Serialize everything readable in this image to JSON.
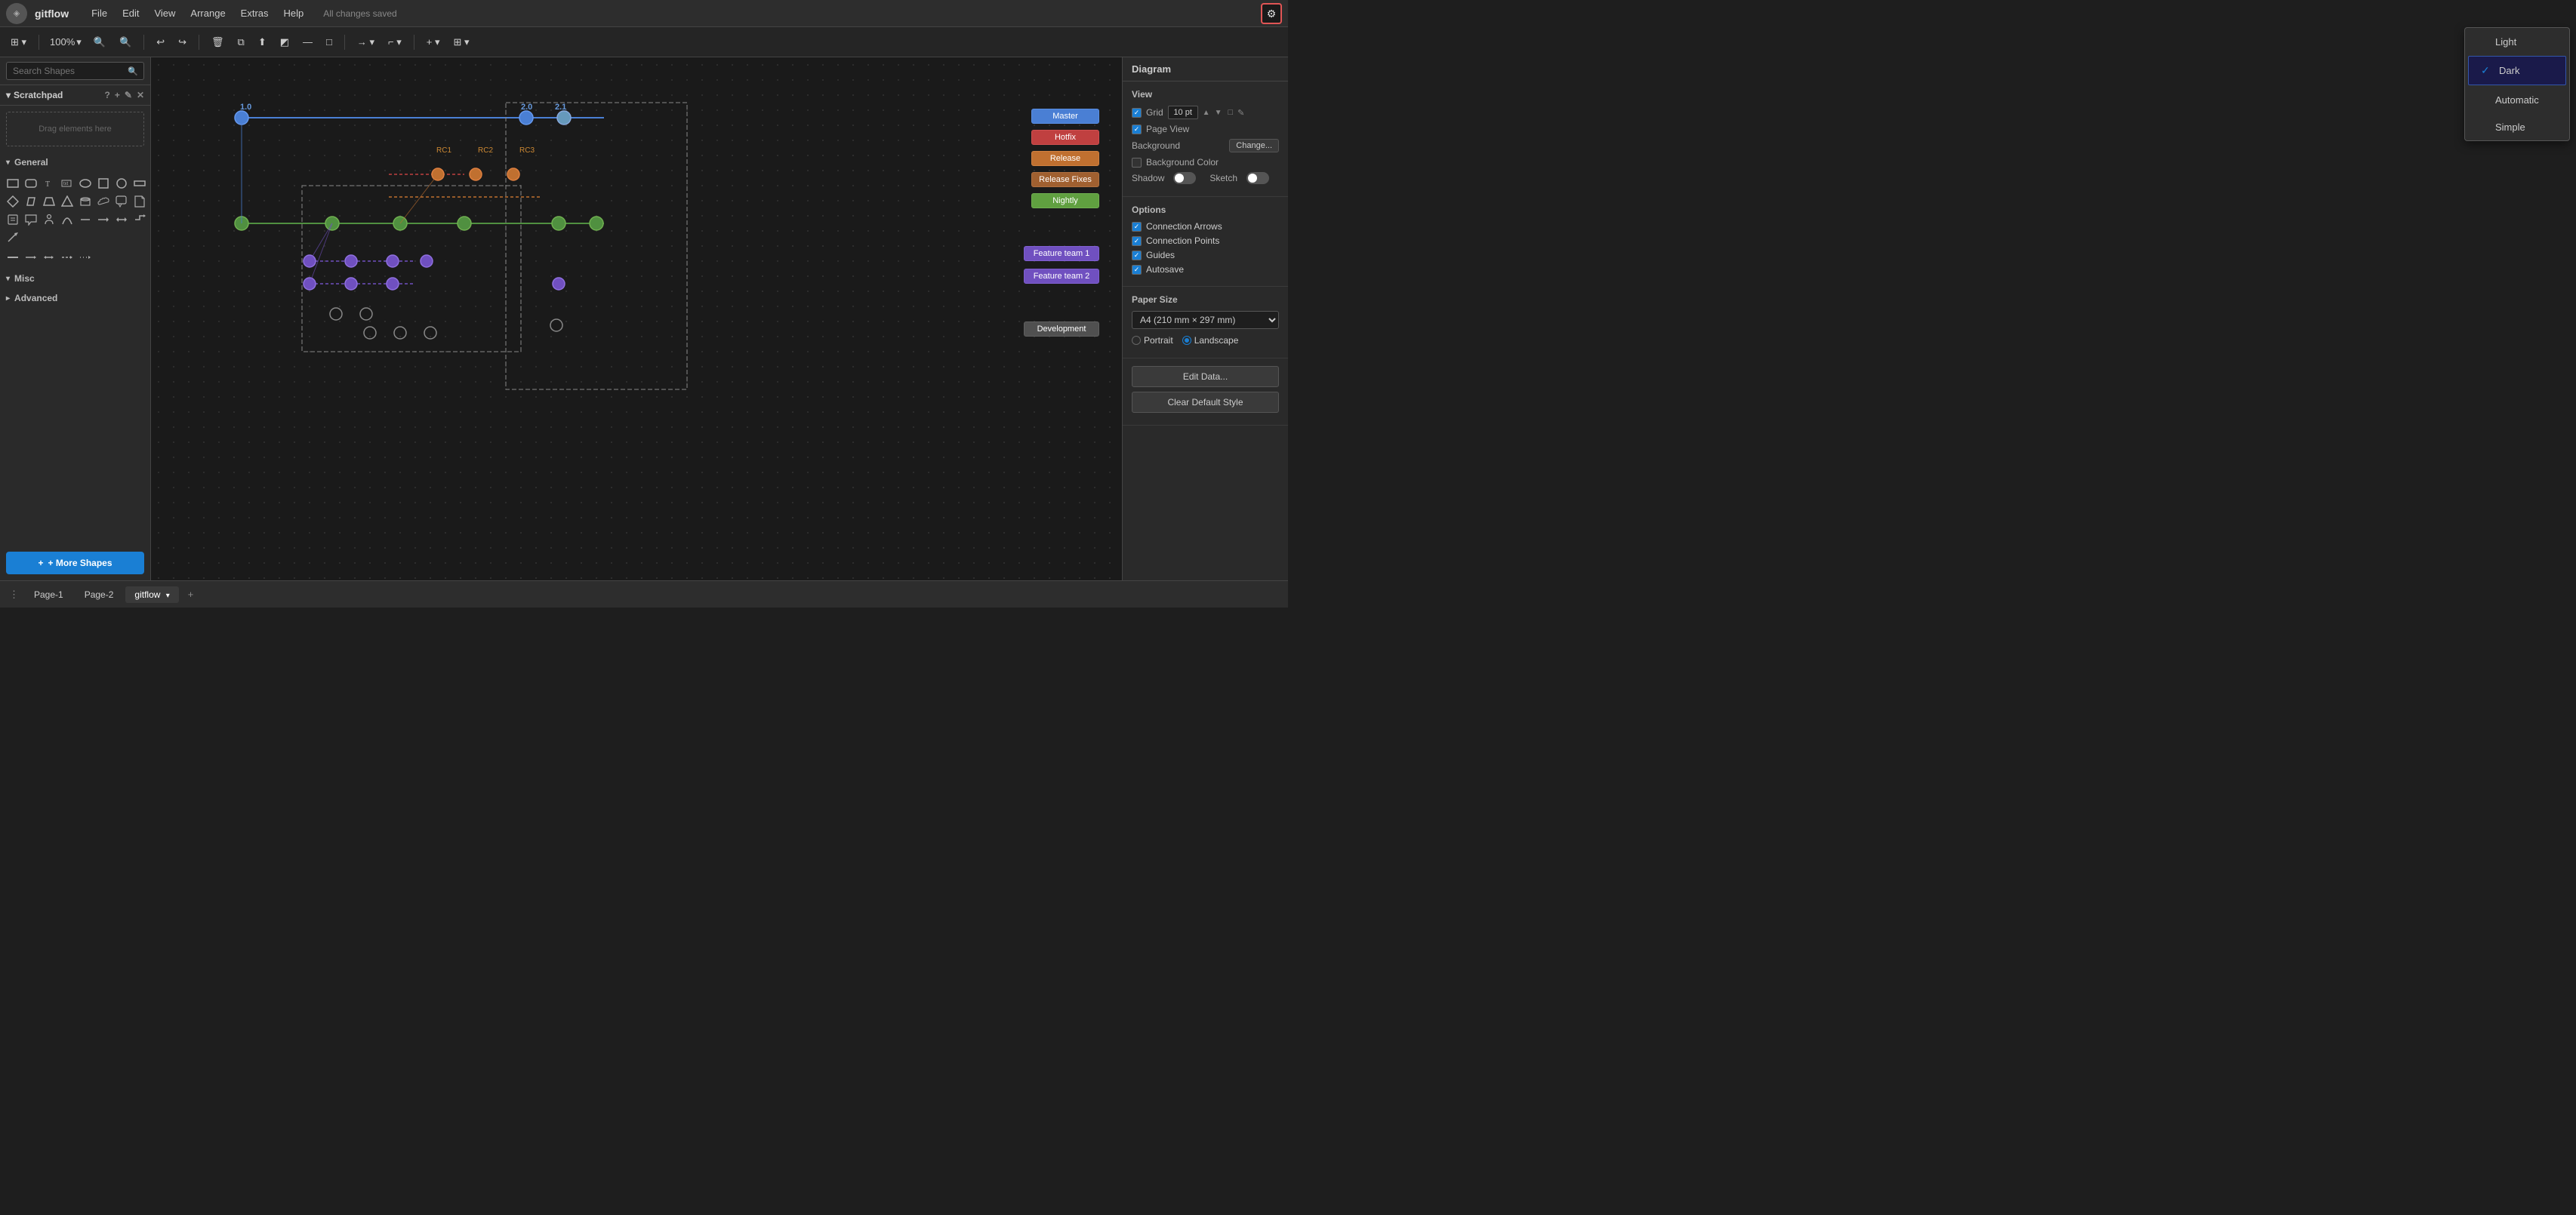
{
  "app": {
    "logo": "◈",
    "title": "gitflow",
    "saved_status": "All changes saved",
    "settings_icon": "⚙"
  },
  "menu": {
    "items": [
      "File",
      "Edit",
      "View",
      "Arrange",
      "Extras",
      "Help"
    ]
  },
  "toolbar": {
    "zoom_level": "100%",
    "zoom_in_icon": "🔍+",
    "zoom_out_icon": "🔍-",
    "undo_icon": "↩",
    "redo_icon": "↪"
  },
  "left_panel": {
    "search_placeholder": "Search Shapes",
    "scratchpad_label": "Scratchpad",
    "scratchpad_drop_text": "Drag elements here",
    "general_label": "General",
    "misc_label": "Misc",
    "advanced_label": "Advanced",
    "more_shapes_label": "+ More Shapes"
  },
  "right_panel": {
    "diagram_label": "Diagram",
    "view_section": "View",
    "grid_label": "Grid",
    "grid_value": "10 pt",
    "page_view_label": "Page View",
    "background_label": "Background",
    "change_label": "Change...",
    "background_color_label": "Background Color",
    "shadow_label": "Shadow",
    "sketch_label": "Sketch",
    "options_section": "Options",
    "connection_arrows_label": "Connection Arrows",
    "connection_points_label": "Connection Points",
    "guides_label": "Guides",
    "autosave_label": "Autosave",
    "paper_size_label": "Paper Size",
    "paper_size_value": "A4 (210 mm × 297 mm)",
    "portrait_label": "Portrait",
    "landscape_label": "Landscape",
    "edit_data_label": "Edit Data...",
    "clear_default_style_label": "Clear Default Style"
  },
  "theme_dropdown": {
    "options": [
      {
        "label": "Light",
        "selected": false
      },
      {
        "label": "Dark",
        "selected": true
      },
      {
        "label": "Automatic",
        "selected": false
      },
      {
        "label": "Simple",
        "selected": false
      }
    ]
  },
  "diagram": {
    "labels": {
      "master": "Master",
      "hotfix": "Hotfix",
      "release": "Release",
      "release_fixes": "Release Fixes",
      "nightly": "Nightly",
      "feature1": "Feature team 1",
      "feature2": "Feature team 2",
      "development": "Development"
    },
    "version_labels": [
      "1.0",
      "2.0",
      "2.1"
    ],
    "rc_labels": [
      "RC1",
      "RC2",
      "RC3"
    ]
  },
  "pages": {
    "tabs": [
      "Page-1",
      "Page-2",
      "gitflow"
    ]
  }
}
